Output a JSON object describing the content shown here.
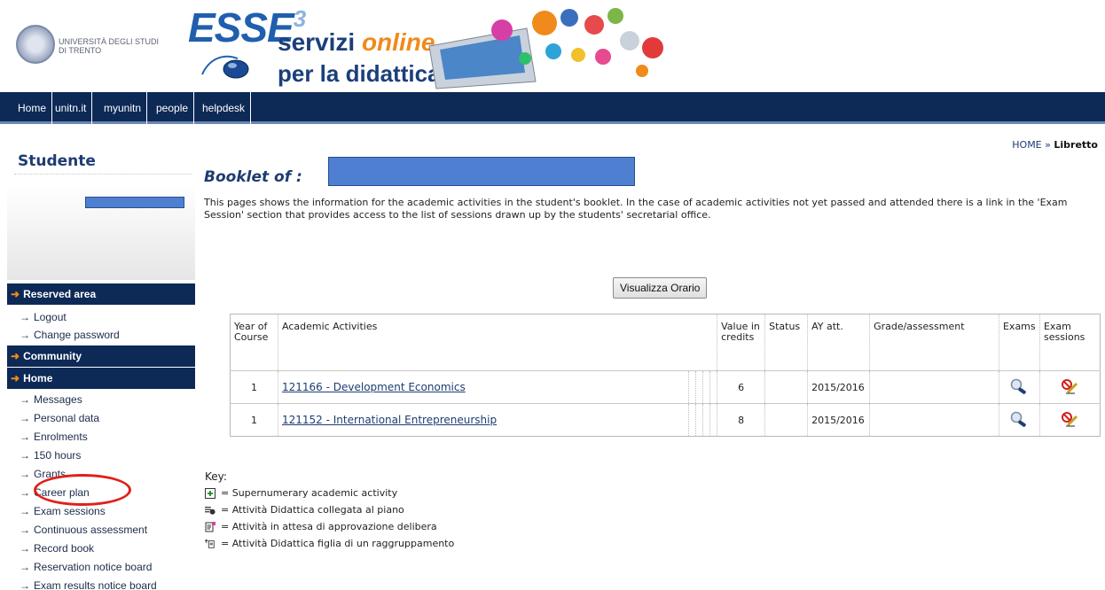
{
  "header": {
    "university_name_line1": "UNIVERSITÀ DEGLI STUDI",
    "university_name_line2": "DI TRENTO",
    "logo_text": "ESSE",
    "logo_sup": "3",
    "tagline_word1": "servizi",
    "tagline_word2": "online",
    "tagline_line2": "per la didattica",
    "accent_color": "#f08a1b",
    "brand_color": "#1e3c72"
  },
  "nav": {
    "items": [
      "Home",
      "unitn.it",
      "myunitn",
      "people",
      "helpdesk"
    ]
  },
  "breadcrumb": {
    "home": "HOME",
    "separator": "»",
    "current": "Libretto"
  },
  "sidebar": {
    "title": "Studente",
    "reserved_area": "Reserved area",
    "reserved_links": [
      "Logout",
      "Change password"
    ],
    "community": "Community",
    "home": "Home",
    "home_links": [
      "Messages",
      "Personal data",
      "Enrolments",
      "150 hours",
      "Grants",
      "Career plan",
      "Exam sessions",
      "Continuous assessment",
      "Record book",
      "Reservation notice board",
      "Exam results notice board"
    ]
  },
  "main": {
    "title": "Booklet of :",
    "intro": "This pages shows the information for the academic activities in the student's booklet. In the case of academic activities not yet passed and attended there is a link in the 'Exam Session' section that provides access to the list of sessions drawn up by the students' secretarial office.",
    "button_label": "Visualizza Orario"
  },
  "table": {
    "headers": {
      "year": "Year of Course",
      "activities": "Academic Activities",
      "credits": "Value in credits",
      "status": "Status",
      "ay": "AY att.",
      "grade": "Grade/assessment",
      "exams": "Exams",
      "sessions": "Exam sessions"
    },
    "rows": [
      {
        "year": "1",
        "activity": "121166 - Development Economics",
        "credits": "6",
        "status": "",
        "ay": "2015/2016",
        "grade": ""
      },
      {
        "year": "1",
        "activity": "121152 - International Entrepreneurship",
        "credits": "8",
        "status": "",
        "ay": "2015/2016",
        "grade": ""
      }
    ]
  },
  "key": {
    "title": "Key:",
    "items": [
      "= Supernumerary academic activity",
      "= Attività Didattica collegata al piano",
      "= Attività in attesa di approvazione delibera",
      "= Attività Didattica figlia di un raggruppamento"
    ]
  }
}
